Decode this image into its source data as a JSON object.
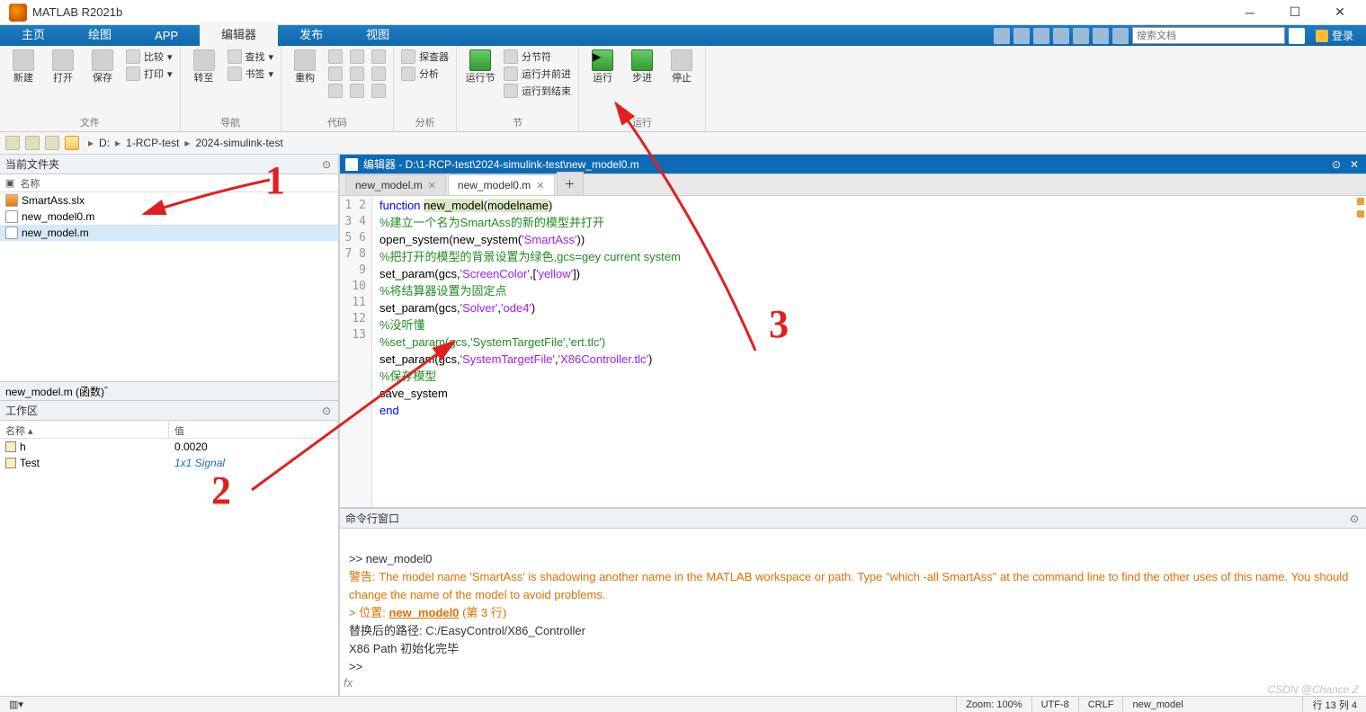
{
  "title": "MATLAB R2021b",
  "ribbonTabs": [
    "主页",
    "绘图",
    "APP",
    "编辑器",
    "发布",
    "视图"
  ],
  "activeRibbonTab": "编辑器",
  "searchPlaceholder": "搜索文档",
  "login": "登录",
  "ribbon": {
    "file": {
      "new": "新建",
      "open": "打开",
      "save": "保存",
      "compare": "比较",
      "print": "打印",
      "group": "文件"
    },
    "nav": {
      "goto": "转至",
      "find": "查找",
      "bookmark": "书签",
      "group": "导航"
    },
    "code": {
      "refactor": "重构",
      "analyze": "分析",
      "group": "代码"
    },
    "analyze": {
      "profiler": "探查器",
      "group": "分析"
    },
    "section": {
      "runsec": "运行节",
      "secbreak": "分节符",
      "runadv": "运行并前进",
      "runend": "运行到结束",
      "group": "节"
    },
    "run": {
      "run": "运行",
      "step": "步进",
      "stop": "停止",
      "group": "运行"
    }
  },
  "path": {
    "root": "D:",
    "segs": [
      "1-RCP-test",
      "2024-simulink-test"
    ]
  },
  "panels": {
    "currentFolder": "当前文件夹",
    "nameCol": "名称",
    "files": [
      {
        "name": "SmartAss.slx",
        "type": "slx"
      },
      {
        "name": "new_model0.m",
        "type": "m"
      },
      {
        "name": "new_model.m",
        "type": "m",
        "sel": true
      }
    ],
    "detail": "new_model.m (函数)",
    "workspace": "工作区",
    "wsCols": [
      "名称 ▴",
      "值"
    ],
    "wsRows": [
      {
        "name": "h",
        "val": "0.0020"
      },
      {
        "name": "Test",
        "val": "1x1 Signal",
        "link": true
      }
    ]
  },
  "editor": {
    "header": "编辑器 - D:\\1-RCP-test\\2024-simulink-test\\new_model0.m",
    "tabs": [
      "new_model.m",
      "new_model0.m"
    ],
    "activeTab": 1,
    "lines": 13
  },
  "code": {
    "l1a": "function ",
    "l1b": "new_model",
    "l1c": "(",
    "l1d": "modelname",
    "l1e": ")",
    "l2": "%建立一个名为SmartAss的新的模型并打开",
    "l3a": "open_system(new_system(",
    "l3b": "'SmartAss'",
    "l3c": "))",
    "l4": "%把打开的模型的背景设置为绿色,gcs=gey current system",
    "l5a": "set_param(gcs,",
    "l5b": "'ScreenColor'",
    "l5c": ",[",
    "l5d": "'yellow'",
    "l5e": "])",
    "l6": "%将结算器设置为固定点",
    "l7a": "set_param(gcs,",
    "l7b": "'Solver'",
    "l7c": ",",
    "l7d": "'ode4'",
    "l7e": ")",
    "l8": "%没听懂",
    "l9": "%set_param(gcs,'SystemTargetFile','ert.tlc')",
    "l10a": "set_param(gcs,",
    "l10b": "'SystemTargetFile'",
    "l10c": ",",
    "l10d": "'X86Controller.tlc'",
    "l10e": ")",
    "l11": "%保存模型",
    "l12": "save_system",
    "l13": "end"
  },
  "cmd": {
    "title": "命令行窗口",
    "prompt": ">> ",
    "call": "new_model0",
    "warnPrefix": "警告: ",
    "warn": "The model name 'SmartAss' is shadowing another name in the MATLAB workspace or path. Type \"which -all SmartAss\" at the command line to find the other uses of this name. You should change the name of the model to avoid problems.",
    "locPrefix": "> 位置: ",
    "locLink": "new_model0",
    "locSuffix": " (第 3 行)",
    "path": "替换后的路径: C:/EasyControl/X86_Controller",
    "init": "X86 Path 初始化完毕"
  },
  "status": {
    "zoom": "Zoom: 100%",
    "enc": "UTF-8",
    "eol": "CRLF",
    "func": "new_model",
    "pos": "行 13    列 4"
  },
  "watermark": "CSDN @Chance Z"
}
